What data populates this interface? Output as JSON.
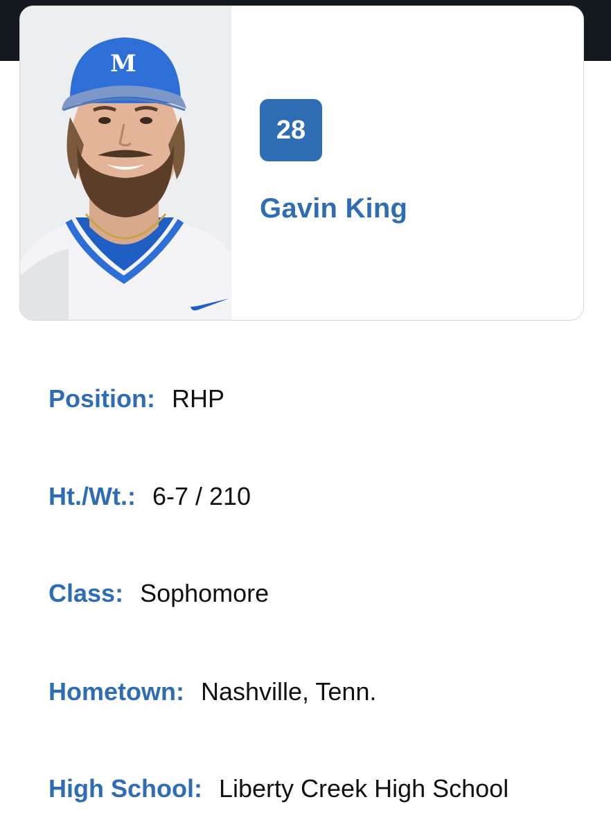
{
  "player": {
    "number": "28",
    "name": "Gavin King",
    "photo_alt": "headshot"
  },
  "details": [
    {
      "label": "Position:",
      "value": "RHP"
    },
    {
      "label": "Ht./Wt.:",
      "value": "6-7 / 210"
    },
    {
      "label": "Class:",
      "value": "Sophomore"
    },
    {
      "label": "Hometown:",
      "value": "Nashville, Tenn."
    },
    {
      "label": "High School:",
      "value": "Liberty Creek High School"
    }
  ],
  "colors": {
    "accent": "#2e6db4",
    "topbar": "#141920",
    "cap": "#2d6fd6",
    "text": "#111111"
  },
  "icons": {
    "cap_logo": "mt-logo",
    "jersey_logo": "swoosh-logo"
  }
}
